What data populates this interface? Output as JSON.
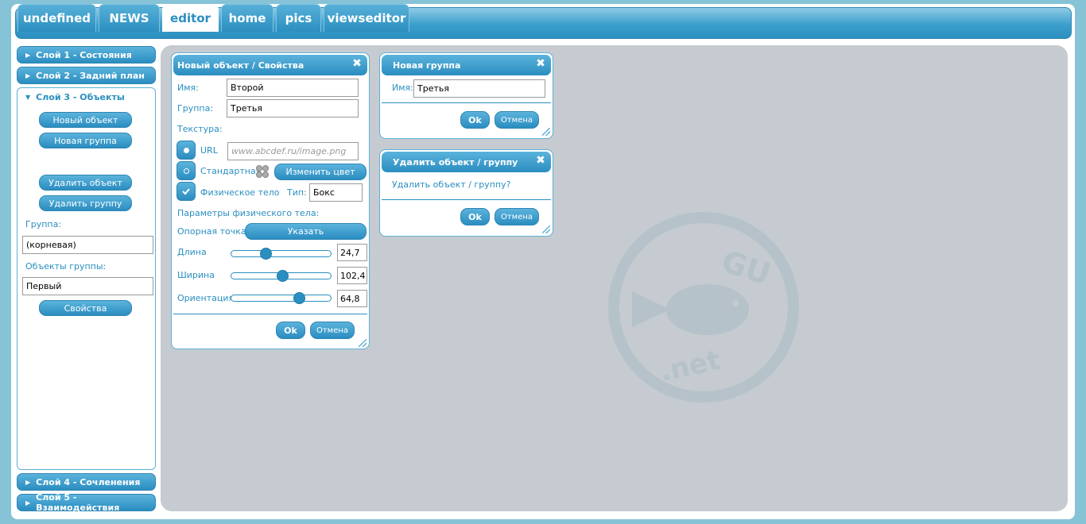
{
  "tabs": [
    "undefined",
    "NEWS",
    "editor",
    "home",
    "pics",
    "viewseditor"
  ],
  "sidebar": {
    "layers": {
      "l1": "Слой 1 - Состояния",
      "l2": "Слой 2 - Задний план",
      "l3": "Слой 3 - Объекты",
      "l4": "Слой  4 - Сочленения",
      "l5": "Слой 5 - Взаимодействия"
    },
    "new_object": "Новый объект",
    "new_group": "Новая группа",
    "delete_object": "Удалить объект",
    "delete_group": "Удалить группу",
    "group_label": "Группа:",
    "group_value": "(корневая)",
    "group_objects_label": "Объекты группы:",
    "group_objects_value": "Первый",
    "properties": "Свойства"
  },
  "props_window": {
    "title": "Новый объект / Свойства",
    "name_label": "Имя:",
    "name_value": "Второй",
    "group_label": "Группа:",
    "group_value": "Третья",
    "texture_label": "Текстура:",
    "url_label": "URL",
    "url_placeholder": "www.abcdef.ru/image.png",
    "standard_label": "Стандартная",
    "change_color": "Изменить цвет",
    "physical_label": "Физическое тело",
    "type_label": "Тип:",
    "type_value": "Бокс",
    "phys_params_label": "Параметры физического тела:",
    "anchor_label": "Опорная точка",
    "anchor_button": "Указать",
    "length_label": "Длина",
    "length_value": "24,7",
    "width_label": "Ширина",
    "width_value": "102,4",
    "orientation_label": "Ориентация",
    "orientation_value": "64,8",
    "ok": "Ok",
    "cancel": "Отмена"
  },
  "group_window": {
    "title": "Новая группа",
    "name_label": "Имя:",
    "name_value": "Третья",
    "ok": "Ok",
    "cancel": "Отмена"
  },
  "delete_window": {
    "title": "Удалить объект / группу",
    "question": "Удалить объект / группу?",
    "ok": "Ok",
    "cancel": "Отмена"
  },
  "watermark": {
    "top": "GU",
    "bottom": ".net"
  },
  "sliders": {
    "length": 0.35,
    "width": 0.52,
    "orientation": 0.69
  },
  "colors": {
    "accent": "#2a8fc0",
    "page_bg": "#86c3d6",
    "canvas": "#c5cbd0"
  }
}
